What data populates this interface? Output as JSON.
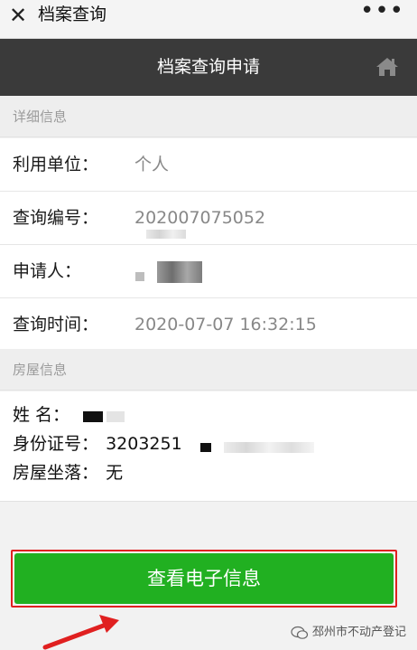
{
  "window": {
    "title": "档案查询",
    "close_glyph": "✕",
    "more_glyph": "•••"
  },
  "header": {
    "title": "档案查询申请",
    "home_icon": "home-icon"
  },
  "detail": {
    "section_title": "详细信息",
    "rows": [
      {
        "label": "利用单位：",
        "value": "个人"
      },
      {
        "label": "查询编号：",
        "value": "202007075052"
      },
      {
        "label": "申请人：",
        "value": ""
      },
      {
        "label": "查询时间：",
        "value": "2020-07-07 16:32:15"
      }
    ]
  },
  "house": {
    "section_title": "房屋信息",
    "name_label": "姓 名：",
    "name_value": "",
    "id_label": "身份证号：",
    "id_value": "3203251",
    "location_label": "房屋坐落：",
    "location_value": "无"
  },
  "action": {
    "button_label": "查看电子信息"
  },
  "watermark": {
    "text": "邳州市不动产登记"
  },
  "colors": {
    "header_bg": "#3a3a3a",
    "button_green": "#21b021",
    "highlight_red": "#e02020"
  }
}
